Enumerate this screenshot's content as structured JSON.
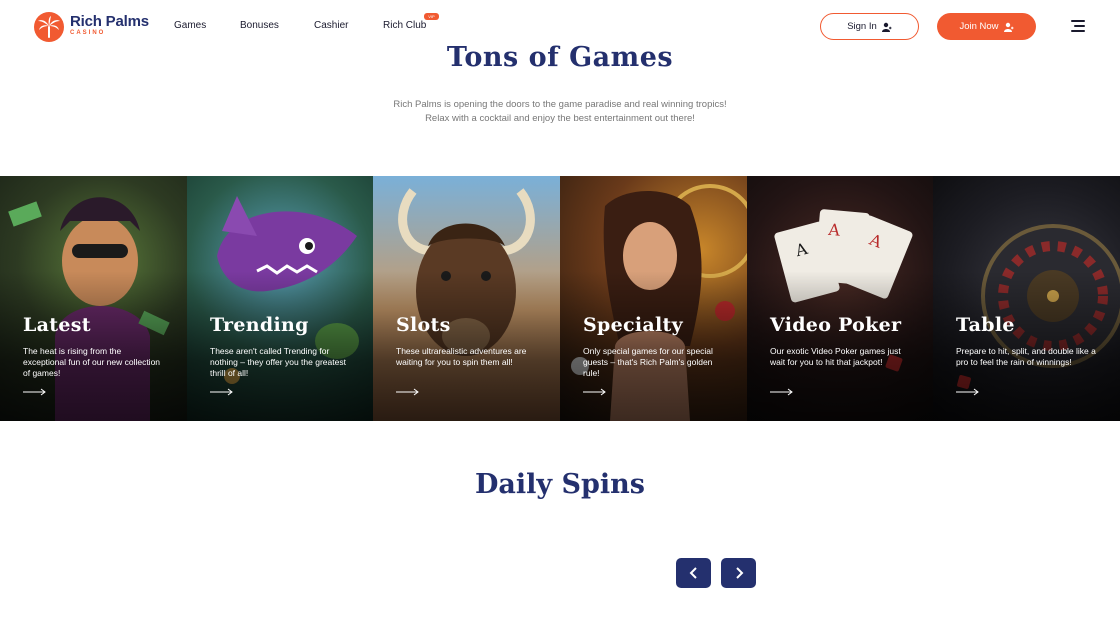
{
  "brand": {
    "name": "Rich Palms",
    "sub": "CASINO",
    "accent": "#f15a31",
    "navy": "#24306e"
  },
  "nav": [
    {
      "label": "Games"
    },
    {
      "label": "Bonuses"
    },
    {
      "label": "Cashier"
    },
    {
      "label": "Rich Club",
      "badge": "VIP"
    }
  ],
  "actions": {
    "sign_in": "Sign In",
    "join_now": "Join Now"
  },
  "games_section": {
    "title": "Tons of Games",
    "subtitle_line1": "Rich Palms is opening the doors to the game paradise and real winning tropics!",
    "subtitle_line2": "Relax with a cocktail and enjoy the best entertainment out there!"
  },
  "categories": [
    {
      "title": "Latest",
      "desc": "The heat is rising from the exceptional fun of our new collection of games!",
      "icon": "arrow-right-icon"
    },
    {
      "title": "Trending",
      "desc": "These aren't called Trending for nothing – they offer you the greatest thrill of all!",
      "icon": "arrow-right-icon"
    },
    {
      "title": "Slots",
      "desc": "These ultrarealistic adventures are waiting for you to spin them all!",
      "icon": "arrow-right-icon"
    },
    {
      "title": "Specialty",
      "desc": "Only special games for our special guests – that's Rich Palm's golden rule!",
      "icon": "arrow-right-icon"
    },
    {
      "title": "Video Poker",
      "desc": "Our exotic Video Poker games just wait for you to hit that jackpot!",
      "icon": "arrow-right-icon"
    },
    {
      "title": "Table",
      "desc": "Prepare to hit, split, and double like a pro to feel the rain of winnings!",
      "icon": "arrow-right-icon"
    }
  ],
  "spins_section": {
    "title": "Daily Spins"
  }
}
